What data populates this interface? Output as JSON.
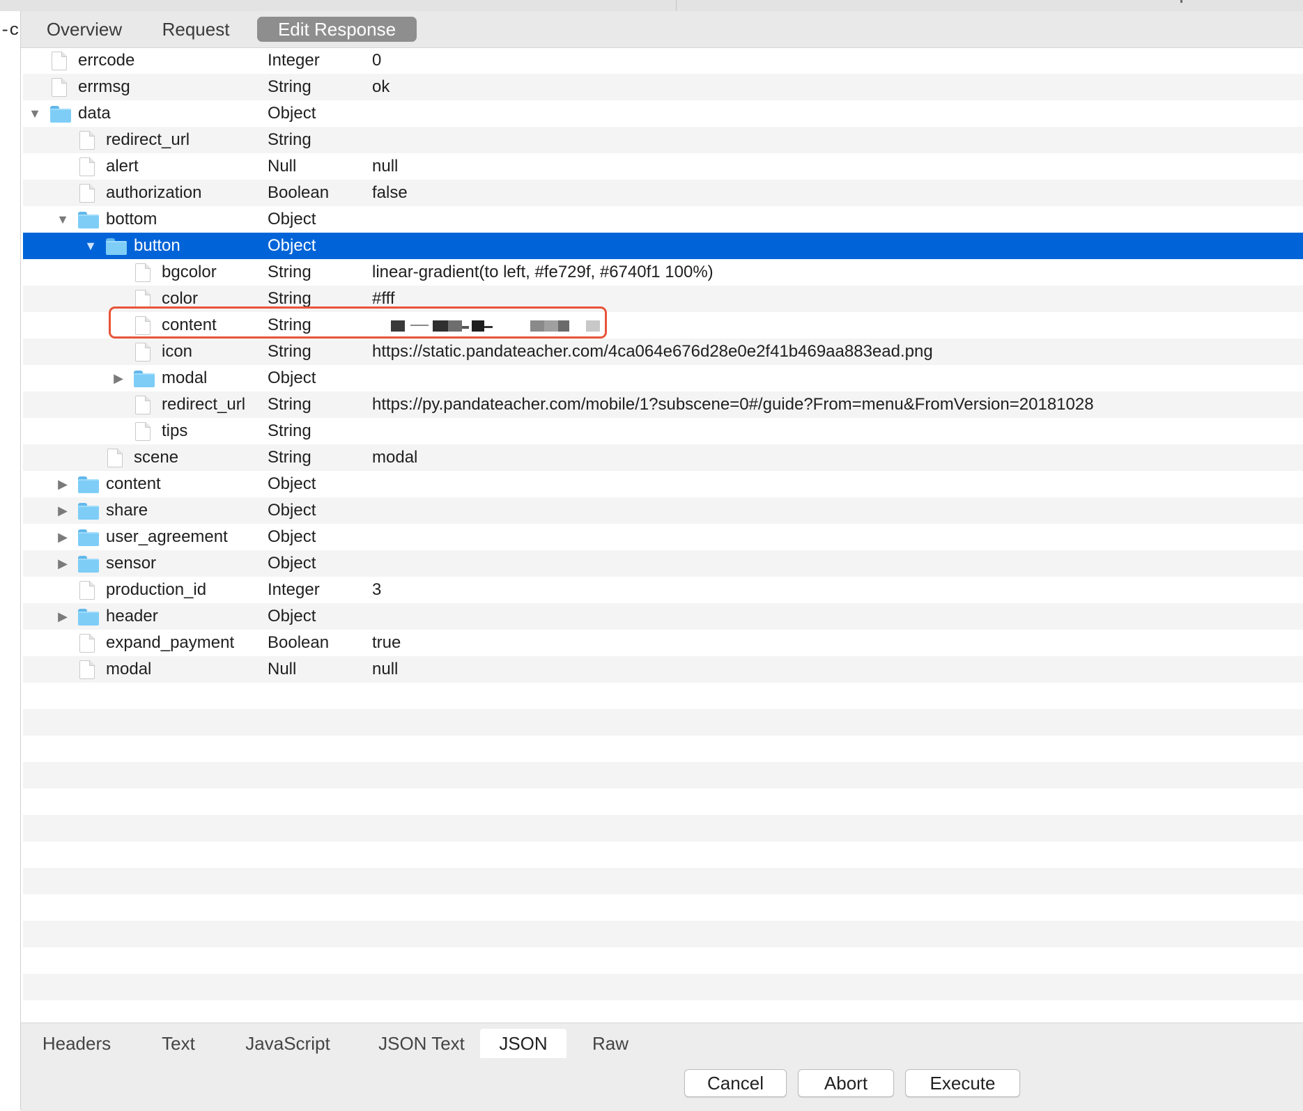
{
  "left_edge": {
    "text": "-c"
  },
  "view_tabs": [
    {
      "label": "Overview"
    },
    {
      "label": "Request"
    },
    {
      "label": "Edit Response",
      "active": true
    }
  ],
  "tree": {
    "rows": [
      {
        "key": "errcode",
        "type": "Integer",
        "value": "0"
      },
      {
        "key": "errmsg",
        "type": "String",
        "value": "ok"
      },
      {
        "key": "data",
        "type": "Object",
        "value": "",
        "expanded": true
      },
      {
        "key": "redirect_url",
        "type": "String",
        "value": ""
      },
      {
        "key": "alert",
        "type": "Null",
        "value": "null"
      },
      {
        "key": "authorization",
        "type": "Boolean",
        "value": "false"
      },
      {
        "key": "bottom",
        "type": "Object",
        "value": "",
        "expanded": true
      },
      {
        "key": "button",
        "type": "Object",
        "value": "",
        "expanded": true,
        "selected": true
      },
      {
        "key": "bgcolor",
        "type": "String",
        "value": "linear-gradient(to left, #fe729f, #6740f1 100%)"
      },
      {
        "key": "color",
        "type": "String",
        "value": "#fff"
      },
      {
        "key": "content",
        "type": "String",
        "value": "",
        "redacted": true,
        "highlighted": true
      },
      {
        "key": "icon",
        "type": "String",
        "value": "https://static.pandateacher.com/4ca064e676d28e0e2f41b469aa883ead.png"
      },
      {
        "key": "modal",
        "type": "Object",
        "value": "",
        "expanded": false
      },
      {
        "key": "redirect_url",
        "type": "String",
        "value": "https://py.pandateacher.com/mobile/1?subscene=0#/guide?From=menu&FromVersion=20181028"
      },
      {
        "key": "tips",
        "type": "String",
        "value": ""
      },
      {
        "key": "scene",
        "type": "String",
        "value": "modal"
      },
      {
        "key": "content",
        "type": "Object",
        "value": "",
        "expanded": false
      },
      {
        "key": "share",
        "type": "Object",
        "value": "",
        "expanded": false
      },
      {
        "key": "user_agreement",
        "type": "Object",
        "value": "",
        "expanded": false
      },
      {
        "key": "sensor",
        "type": "Object",
        "value": "",
        "expanded": false
      },
      {
        "key": "production_id",
        "type": "Integer",
        "value": "3"
      },
      {
        "key": "header",
        "type": "Object",
        "value": "",
        "expanded": false
      },
      {
        "key": "expand_payment",
        "type": "Boolean",
        "value": "true"
      },
      {
        "key": "modal",
        "type": "Null",
        "value": "null"
      }
    ]
  },
  "format_tabs": [
    {
      "label": "Headers"
    },
    {
      "label": "Text"
    },
    {
      "label": "JavaScript"
    },
    {
      "label": "JSON Text"
    },
    {
      "label": "JSON",
      "active": true
    },
    {
      "label": "Raw"
    }
  ],
  "actions": {
    "cancel": "Cancel",
    "abort": "Abort",
    "execute": "Execute"
  },
  "colors": {
    "selection": "#0064d8",
    "highlight_border": "#e8543a",
    "folder": "#7ecdf7",
    "active_tab": "#8e8e8e"
  },
  "icons": {
    "leaf": "file-icon",
    "object": "folder-icon",
    "expanded": "triangle-down-icon",
    "collapsed": "triangle-right-icon"
  }
}
